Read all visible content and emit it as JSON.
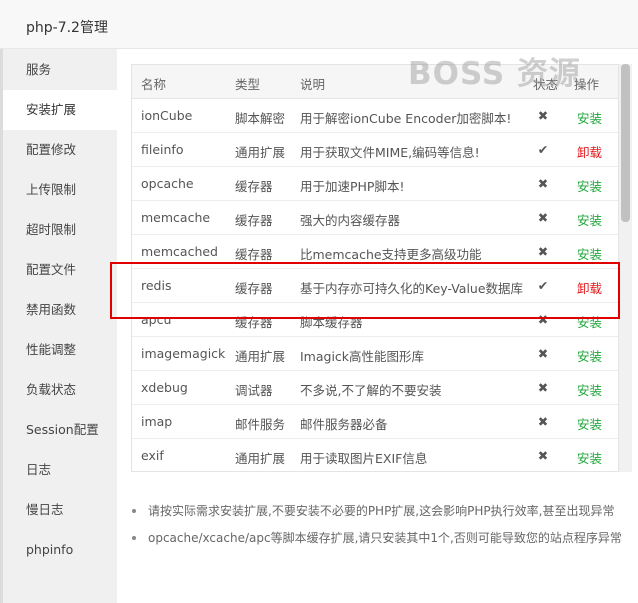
{
  "window": {
    "title": "php-7.2管理"
  },
  "watermark": "BOSS 资源",
  "sidebar": {
    "items": [
      {
        "label": "服务",
        "active": false
      },
      {
        "label": "安装扩展",
        "active": true
      },
      {
        "label": "配置修改",
        "active": false
      },
      {
        "label": "上传限制",
        "active": false
      },
      {
        "label": "超时限制",
        "active": false
      },
      {
        "label": "配置文件",
        "active": false
      },
      {
        "label": "禁用函数",
        "active": false
      },
      {
        "label": "性能调整",
        "active": false
      },
      {
        "label": "负载状态",
        "active": false
      },
      {
        "label": "Session配置",
        "active": false
      },
      {
        "label": "日志",
        "active": false
      },
      {
        "label": "慢日志",
        "active": false
      },
      {
        "label": "phpinfo",
        "active": false
      }
    ]
  },
  "table": {
    "headers": {
      "name": "名称",
      "type": "类型",
      "desc": "说明",
      "status": "状态",
      "action": "操作"
    },
    "rows": [
      {
        "name": "ionCube",
        "type": "脚本解密",
        "desc": "用于解密ionCube Encoder加密脚本!",
        "status": "✖",
        "action": "安装"
      },
      {
        "name": "fileinfo",
        "type": "通用扩展",
        "desc": "用于获取文件MIME,编码等信息!",
        "status": "✔",
        "action": "卸载"
      },
      {
        "name": "opcache",
        "type": "缓存器",
        "desc": "用于加速PHP脚本!",
        "status": "✖",
        "action": "安装"
      },
      {
        "name": "memcache",
        "type": "缓存器",
        "desc": "强大的内容缓存器",
        "status": "✖",
        "action": "安装"
      },
      {
        "name": "memcached",
        "type": "缓存器",
        "desc": "比memcache支持更多高级功能",
        "status": "✖",
        "action": "安装"
      },
      {
        "name": "redis",
        "type": "缓存器",
        "desc": "基于内存亦可持久化的Key-Value数据库",
        "status": "✔",
        "action": "卸载"
      },
      {
        "name": "apcu",
        "type": "缓存器",
        "desc": "脚本缓存器",
        "status": "✖",
        "action": "安装"
      },
      {
        "name": "imagemagick",
        "type": "通用扩展",
        "desc": "Imagick高性能图形库",
        "status": "✖",
        "action": "安装"
      },
      {
        "name": "xdebug",
        "type": "调试器",
        "desc": "不多说,不了解的不要安装",
        "status": "✖",
        "action": "安装"
      },
      {
        "name": "imap",
        "type": "邮件服务",
        "desc": "邮件服务器必备",
        "status": "✖",
        "action": "安装"
      },
      {
        "name": "exif",
        "type": "通用扩展",
        "desc": "用于读取图片EXIF信息",
        "status": "✖",
        "action": "安装"
      }
    ]
  },
  "notes": [
    "请按实际需求安装扩展,不要安装不必要的PHP扩展,这会影响PHP执行效率,甚至出现异常",
    "opcache/xcache/apc等脚本缓存扩展,请只安装其中1个,否则可能导致您的站点程序异常"
  ],
  "colors": {
    "install": "#20a53a",
    "uninstall": "#e0191c",
    "highlight": "#e00000"
  }
}
